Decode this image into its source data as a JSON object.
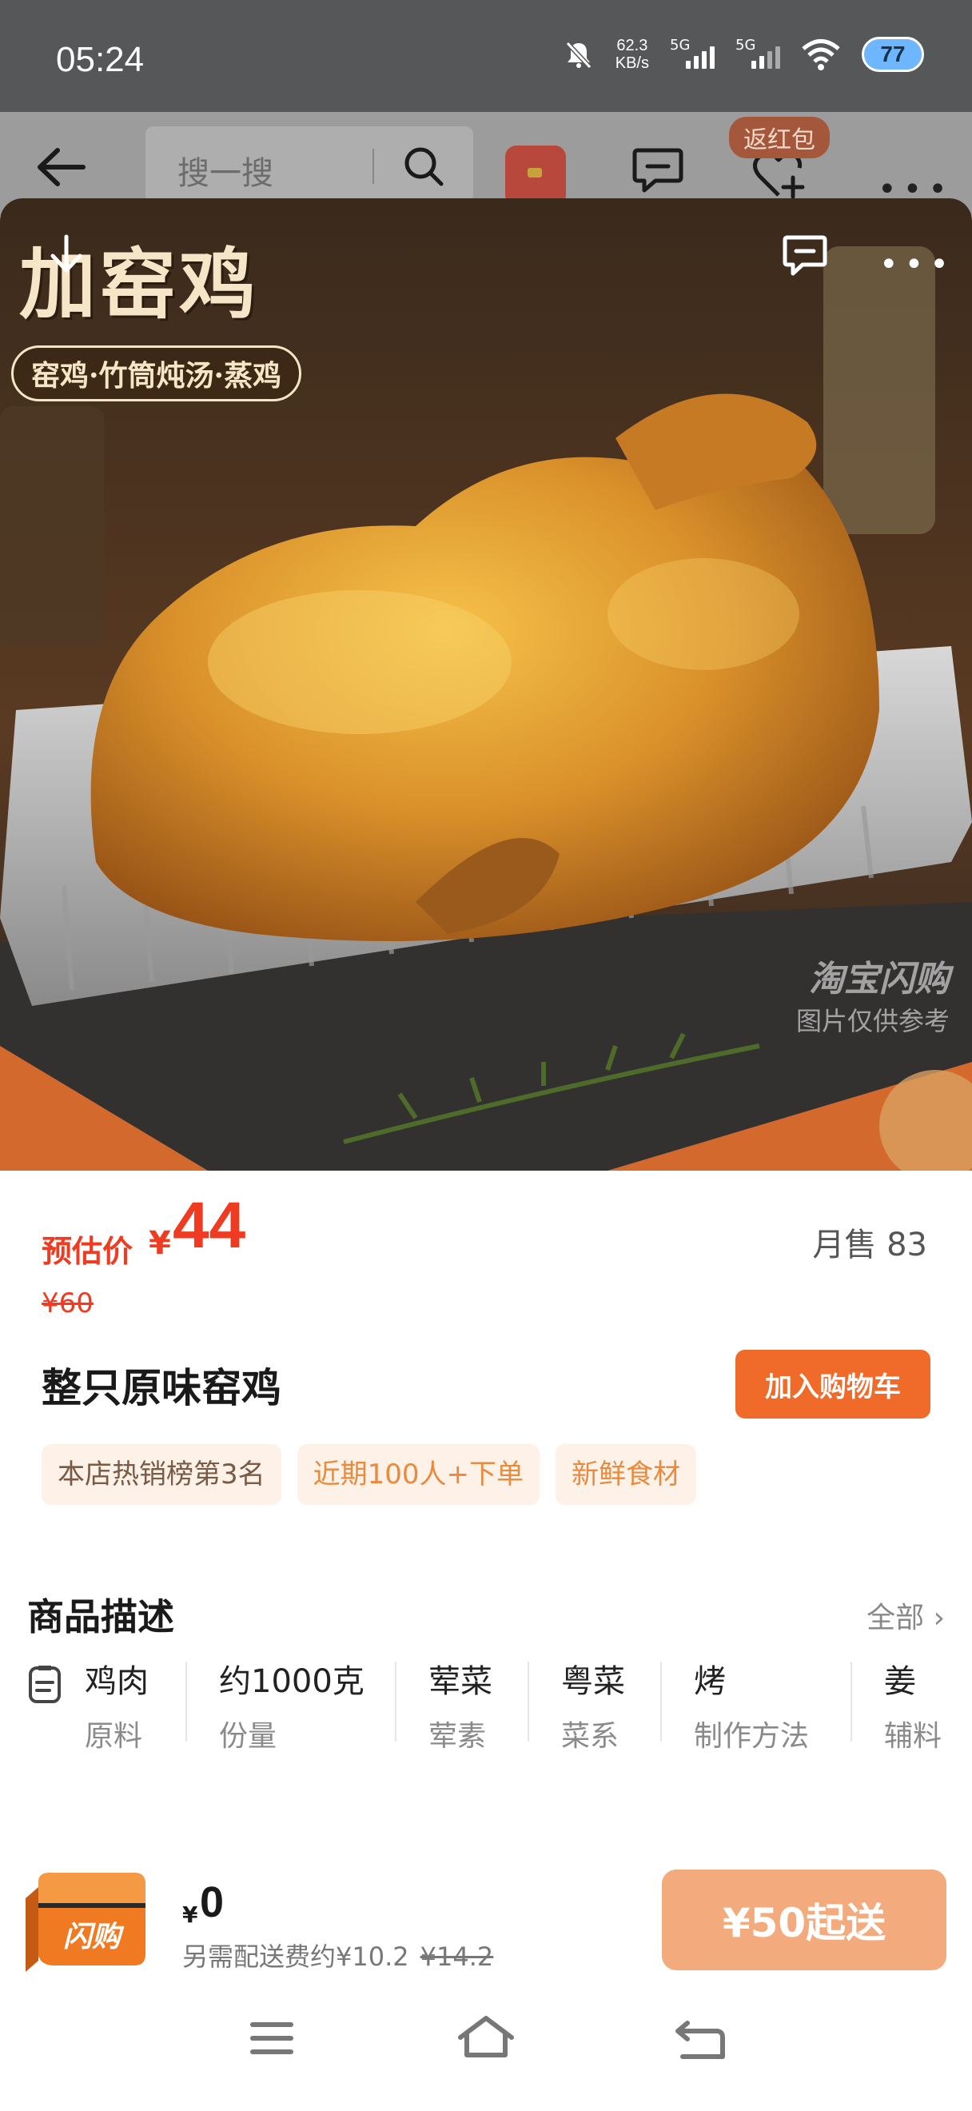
{
  "status_bar": {
    "time": "05:24",
    "net_speed_value": "62.3",
    "net_speed_unit": "KB/s",
    "signal1_label": "5G",
    "signal2_label": "5G",
    "battery": "77"
  },
  "header": {
    "search_placeholder": "搜一搜",
    "badge": "返红包"
  },
  "hero": {
    "banner_title": "加窑鸡",
    "banner_subtitle": "窑鸡·竹筒炖汤·蒸鸡",
    "watermark_line1": "淘宝闪购",
    "watermark_line2": "图片仅供参考"
  },
  "product": {
    "price_label": "预估价",
    "currency": "¥",
    "price": "44",
    "original_price": "¥60",
    "monthly_sales": "月售 83",
    "name": "整只原味窑鸡",
    "add_to_cart": "加入购物车",
    "tags": [
      "本店热销榜第3名",
      "近期100人+下单",
      "新鲜食材"
    ]
  },
  "description": {
    "title": "商品描述",
    "all_label": "全部",
    "attributes": [
      {
        "value": "鸡肉",
        "key": "原料"
      },
      {
        "value": "约1000克",
        "key": "份量"
      },
      {
        "value": "荤菜",
        "key": "荤素"
      },
      {
        "value": "粤菜",
        "key": "菜系"
      },
      {
        "value": "烤",
        "key": "制作方法"
      },
      {
        "value": "姜",
        "key": "辅料"
      }
    ]
  },
  "bottom_bar": {
    "bag_label": "闪购",
    "currency": "¥",
    "amount": "0",
    "delivery_note": "另需配送费约¥10.2",
    "delivery_original": "¥14.2",
    "min_order_button": "¥50起送"
  }
}
